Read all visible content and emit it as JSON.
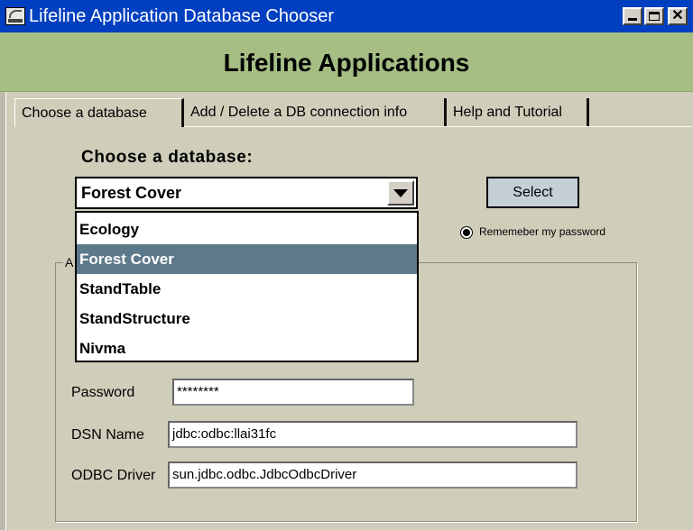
{
  "window": {
    "title": "Lifeline Application Database Chooser"
  },
  "banner": {
    "title": "Lifeline Applications"
  },
  "tabs": [
    {
      "label": "Choose a database"
    },
    {
      "label": "Add / Delete a DB connection info"
    },
    {
      "label": "Help and Tutorial"
    }
  ],
  "chooser": {
    "label": "Choose a database:",
    "selected": "Forest Cover",
    "options": [
      "Ecology",
      "Forest Cover",
      "StandTable",
      "StandStructure",
      "Nivma"
    ],
    "select_button": "Select",
    "remember_label": "Rememeber my password"
  },
  "group": {
    "title": "A"
  },
  "fields": {
    "password_label": "Password",
    "password_value": "********",
    "dsn_label": "DSN Name",
    "dsn_value": "jdbc:odbc:llai31fc",
    "driver_label": "ODBC Driver",
    "driver_value": "sun.jdbc.odbc.JdbcOdbcDriver"
  },
  "colors": {
    "titlebar": "#003fbf",
    "banner": "#a6be84",
    "background": "#cfceba",
    "selection": "#5d7a8a",
    "select_button": "#c4cfd6"
  }
}
